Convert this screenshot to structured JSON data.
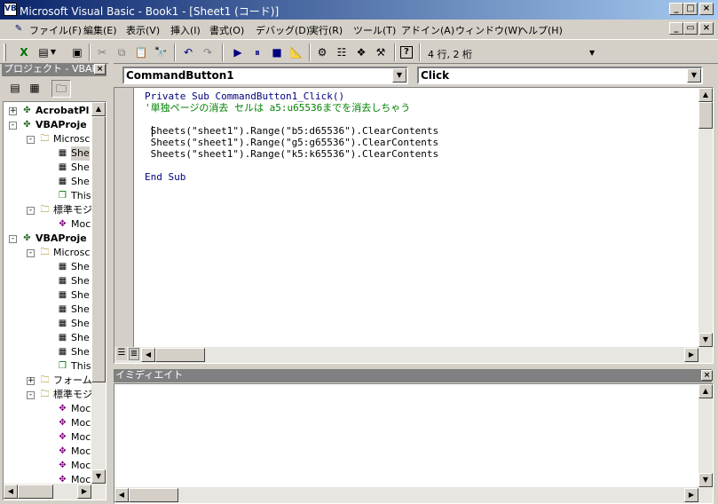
{
  "window": {
    "title": "Microsoft Visual Basic - Book1 - [Sheet1 (コード)]",
    "min": "_",
    "max": "□",
    "close": "×",
    "child_min": "_",
    "child_restore": "▭",
    "child_close": "×"
  },
  "menu": [
    "ファイル(F)",
    "編集(E)",
    "表示(V)",
    "挿入(I)",
    "書式(O)",
    "デバッグ(D)",
    "実行(R)",
    "ツール(T)",
    "アドイン(A)",
    "ウィンドウ(W)",
    "ヘルプ(H)"
  ],
  "toolbar": {
    "position": "4 行, 2 桁"
  },
  "project": {
    "title": "プロジェクト - VBAPr",
    "items": [
      {
        "pm": "+",
        "icon": "vba",
        "label": "AcrobatPl",
        "bold": true,
        "level": 0
      },
      {
        "pm": "-",
        "icon": "vba",
        "label": "VBAProje",
        "bold": true,
        "level": 0
      },
      {
        "pm": "-",
        "icon": "folder",
        "label": "Microsc",
        "bold": false,
        "level": 1
      },
      {
        "pm": "",
        "icon": "sheet",
        "label": "She",
        "bold": false,
        "level": 2,
        "selected": true
      },
      {
        "pm": "",
        "icon": "sheet",
        "label": "She",
        "bold": false,
        "level": 2
      },
      {
        "pm": "",
        "icon": "sheet",
        "label": "She",
        "bold": false,
        "level": 2
      },
      {
        "pm": "",
        "icon": "book",
        "label": "This",
        "bold": false,
        "level": 2
      },
      {
        "pm": "-",
        "icon": "folder",
        "label": "標準モジ",
        "bold": false,
        "level": 1
      },
      {
        "pm": "",
        "icon": "module",
        "label": "Moc",
        "bold": false,
        "level": 2
      },
      {
        "pm": "-",
        "icon": "vba",
        "label": "VBAProje",
        "bold": true,
        "level": 0
      },
      {
        "pm": "-",
        "icon": "folder",
        "label": "Microsc",
        "bold": false,
        "level": 1
      },
      {
        "pm": "",
        "icon": "sheet",
        "label": "She",
        "bold": false,
        "level": 2
      },
      {
        "pm": "",
        "icon": "sheet",
        "label": "She",
        "bold": false,
        "level": 2
      },
      {
        "pm": "",
        "icon": "sheet",
        "label": "She",
        "bold": false,
        "level": 2
      },
      {
        "pm": "",
        "icon": "sheet",
        "label": "She",
        "bold": false,
        "level": 2
      },
      {
        "pm": "",
        "icon": "sheet",
        "label": "She",
        "bold": false,
        "level": 2
      },
      {
        "pm": "",
        "icon": "sheet",
        "label": "She",
        "bold": false,
        "level": 2
      },
      {
        "pm": "",
        "icon": "sheet",
        "label": "She",
        "bold": false,
        "level": 2
      },
      {
        "pm": "",
        "icon": "book",
        "label": "This",
        "bold": false,
        "level": 2
      },
      {
        "pm": "+",
        "icon": "folder",
        "label": "フォーム",
        "bold": false,
        "level": 1
      },
      {
        "pm": "-",
        "icon": "folder",
        "label": "標準モジ",
        "bold": false,
        "level": 1
      },
      {
        "pm": "",
        "icon": "module",
        "label": "Moc",
        "bold": false,
        "level": 2
      },
      {
        "pm": "",
        "icon": "module",
        "label": "Moc",
        "bold": false,
        "level": 2
      },
      {
        "pm": "",
        "icon": "module",
        "label": "Moc",
        "bold": false,
        "level": 2
      },
      {
        "pm": "",
        "icon": "module",
        "label": "Moc",
        "bold": false,
        "level": 2
      },
      {
        "pm": "",
        "icon": "module",
        "label": "Moc",
        "bold": false,
        "level": 2
      },
      {
        "pm": "",
        "icon": "module",
        "label": "Moc",
        "bold": false,
        "level": 2
      }
    ]
  },
  "code": {
    "object": "CommandButton1",
    "procedure": "Click",
    "lines": [
      {
        "text": "Private Sub CommandButton1_Click()",
        "type": "kw"
      },
      {
        "text": "'単独ページの消去 セルは a5:u65536までを消去しちゃう",
        "type": "cm"
      },
      {
        "text": "",
        "type": "n"
      },
      {
        "text": " Sheets(\"sheet1\").Range(\"b5:d65536\").ClearContents",
        "type": "n"
      },
      {
        "text": " Sheets(\"sheet1\").Range(\"g5:g65536\").ClearContents",
        "type": "n"
      },
      {
        "text": " Sheets(\"sheet1\").Range(\"k5:k65536\").ClearContents",
        "type": "n"
      },
      {
        "text": "",
        "type": "n"
      },
      {
        "text": "End Sub",
        "type": "kw"
      }
    ]
  },
  "immediate": {
    "title": "イミディエイト"
  }
}
